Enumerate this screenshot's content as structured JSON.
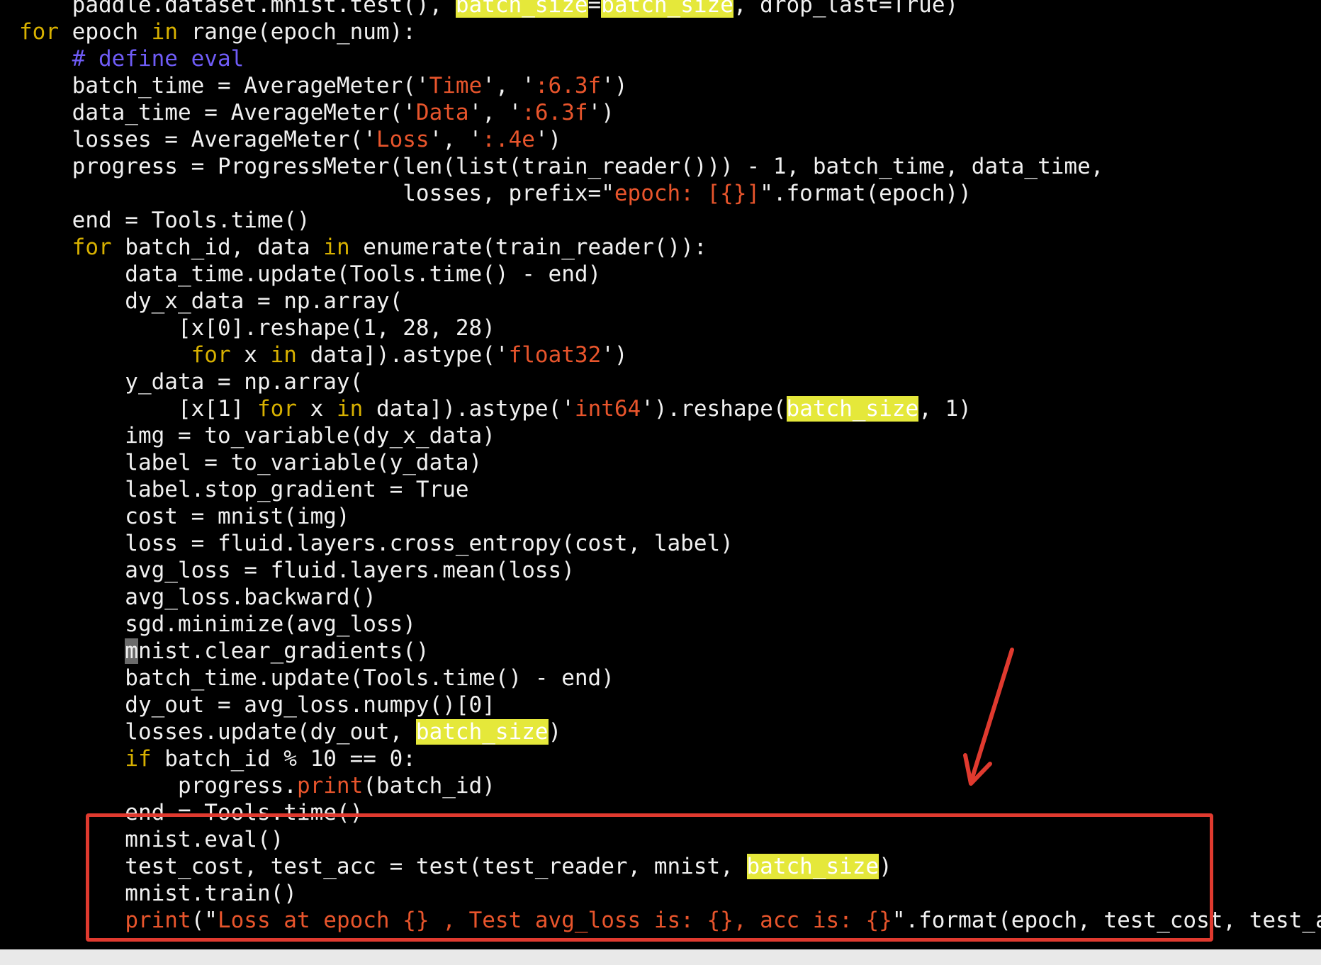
{
  "code": {
    "lines": [
      {
        "segments": [
          {
            "t": "    paddle.dataset.mnist.test(), ",
            "c": "p"
          },
          {
            "t": "batch_size",
            "c": "hl"
          },
          {
            "t": "=",
            "c": "p"
          },
          {
            "t": "batch_size",
            "c": "hl"
          },
          {
            "t": ", drop_last=True)",
            "c": "p"
          }
        ]
      },
      {
        "segments": [
          {
            "t": "for",
            "c": "kw"
          },
          {
            "t": " epoch ",
            "c": "p"
          },
          {
            "t": "in",
            "c": "kw"
          },
          {
            "t": " range(epoch_num):",
            "c": "p"
          }
        ]
      },
      {
        "segments": [
          {
            "t": "    ",
            "c": "p"
          },
          {
            "t": "# define eval",
            "c": "com"
          }
        ]
      },
      {
        "segments": [
          {
            "t": "    batch_time = AverageMeter('",
            "c": "p"
          },
          {
            "t": "Time",
            "c": "str"
          },
          {
            "t": "', '",
            "c": "p"
          },
          {
            "t": ":6.3f",
            "c": "str"
          },
          {
            "t": "')",
            "c": "p"
          }
        ]
      },
      {
        "segments": [
          {
            "t": "    data_time = AverageMeter('",
            "c": "p"
          },
          {
            "t": "Data",
            "c": "str"
          },
          {
            "t": "', '",
            "c": "p"
          },
          {
            "t": ":6.3f",
            "c": "str"
          },
          {
            "t": "')",
            "c": "p"
          }
        ]
      },
      {
        "segments": [
          {
            "t": "    losses = AverageMeter('",
            "c": "p"
          },
          {
            "t": "Loss",
            "c": "str"
          },
          {
            "t": "', '",
            "c": "p"
          },
          {
            "t": ":.4e",
            "c": "str"
          },
          {
            "t": "')",
            "c": "p"
          }
        ]
      },
      {
        "segments": [
          {
            "t": "    progress = ProgressMeter(len(list(train_reader())) - 1, batch_time, data_time,",
            "c": "p"
          }
        ]
      },
      {
        "segments": [
          {
            "t": "                             losses, prefix=\"",
            "c": "p"
          },
          {
            "t": "epoch: [{}]",
            "c": "str"
          },
          {
            "t": "\".format(epoch))",
            "c": "p"
          }
        ]
      },
      {
        "segments": [
          {
            "t": "    end = Tools.time()",
            "c": "p"
          }
        ]
      },
      {
        "segments": [
          {
            "t": "    ",
            "c": "p"
          },
          {
            "t": "for",
            "c": "kw"
          },
          {
            "t": " batch_id, data ",
            "c": "p"
          },
          {
            "t": "in",
            "c": "kw"
          },
          {
            "t": " enumerate(train_reader()):",
            "c": "p"
          }
        ]
      },
      {
        "segments": [
          {
            "t": "        data_time.update(Tools.time() - end)",
            "c": "p"
          }
        ]
      },
      {
        "segments": [
          {
            "t": "        dy_x_data = np.array(",
            "c": "p"
          }
        ]
      },
      {
        "segments": [
          {
            "t": "            [x[0].reshape(1, 28, 28)",
            "c": "p"
          }
        ]
      },
      {
        "segments": [
          {
            "t": "             ",
            "c": "p"
          },
          {
            "t": "for",
            "c": "kw"
          },
          {
            "t": " x ",
            "c": "p"
          },
          {
            "t": "in",
            "c": "kw"
          },
          {
            "t": " data]).astype('",
            "c": "p"
          },
          {
            "t": "float32",
            "c": "str"
          },
          {
            "t": "')",
            "c": "p"
          }
        ]
      },
      {
        "segments": [
          {
            "t": "        y_data = np.array(",
            "c": "p"
          }
        ]
      },
      {
        "segments": [
          {
            "t": "            [x[1] ",
            "c": "p"
          },
          {
            "t": "for",
            "c": "kw"
          },
          {
            "t": " x ",
            "c": "p"
          },
          {
            "t": "in",
            "c": "kw"
          },
          {
            "t": " data]).astype('",
            "c": "p"
          },
          {
            "t": "int64",
            "c": "str"
          },
          {
            "t": "').reshape(",
            "c": "p"
          },
          {
            "t": "batch_size",
            "c": "hl"
          },
          {
            "t": ", 1)",
            "c": "p"
          }
        ]
      },
      {
        "segments": [
          {
            "t": "        img = to_variable(dy_x_data)",
            "c": "p"
          }
        ]
      },
      {
        "segments": [
          {
            "t": "        label = to_variable(y_data)",
            "c": "p"
          }
        ]
      },
      {
        "segments": [
          {
            "t": "        label.stop_gradient = True",
            "c": "p"
          }
        ]
      },
      {
        "segments": [
          {
            "t": "        cost = mnist(img)",
            "c": "p"
          }
        ]
      },
      {
        "segments": [
          {
            "t": "        loss = fluid.layers.cross_entropy(cost, label)",
            "c": "p"
          }
        ]
      },
      {
        "segments": [
          {
            "t": "        avg_loss = fluid.layers.mean(loss)",
            "c": "p"
          }
        ]
      },
      {
        "segments": [
          {
            "t": "        avg_loss.backward()",
            "c": "p"
          }
        ]
      },
      {
        "segments": [
          {
            "t": "        sgd.minimize(avg_loss)",
            "c": "p"
          }
        ]
      },
      {
        "segments": [
          {
            "t": "        ",
            "c": "p"
          },
          {
            "t": "m",
            "c": "cur"
          },
          {
            "t": "nist.clear_gradients()",
            "c": "p"
          }
        ]
      },
      {
        "segments": [
          {
            "t": "        batch_time.update(Tools.time() - end)",
            "c": "p"
          }
        ]
      },
      {
        "segments": [
          {
            "t": "        dy_out = avg_loss.numpy()[0]",
            "c": "p"
          }
        ]
      },
      {
        "segments": [
          {
            "t": "        losses.update(dy_out, ",
            "c": "p"
          },
          {
            "t": "batch_size",
            "c": "hl"
          },
          {
            "t": ")",
            "c": "p"
          }
        ]
      },
      {
        "segments": [
          {
            "t": "        ",
            "c": "p"
          },
          {
            "t": "if",
            "c": "kw"
          },
          {
            "t": " batch_id % 10 == 0:",
            "c": "p"
          }
        ]
      },
      {
        "segments": [
          {
            "t": "            progress.",
            "c": "p"
          },
          {
            "t": "print",
            "c": "str"
          },
          {
            "t": "(batch_id)",
            "c": "p"
          }
        ]
      },
      {
        "segments": [
          {
            "t": "        end = Tools.time()",
            "c": "p"
          }
        ]
      },
      {
        "segments": [
          {
            "t": "        mnist.eval()",
            "c": "p"
          }
        ]
      },
      {
        "segments": [
          {
            "t": "        test_cost, test_acc = test(test_reader, mnist, ",
            "c": "p"
          },
          {
            "t": "batch_size",
            "c": "hl"
          },
          {
            "t": ")",
            "c": "p"
          }
        ]
      },
      {
        "segments": [
          {
            "t": "        mnist.train()",
            "c": "p"
          }
        ]
      },
      {
        "segments": [
          {
            "t": "        ",
            "c": "p"
          },
          {
            "t": "print",
            "c": "str"
          },
          {
            "t": "(\"",
            "c": "p"
          },
          {
            "t": "Loss at epoch {} , Test avg_loss is: {}, acc is: {}",
            "c": "str"
          },
          {
            "t": "\".format(epoch, test_cost, test_acc))",
            "c": "p"
          }
        ]
      }
    ]
  },
  "annotation": {
    "box_color": "#e03a2f",
    "arrow_color": "#e03a2f"
  },
  "colors": {
    "background": "#000000",
    "plain_text": "#f0f0f0",
    "keyword": "#d8b100",
    "string": "#e8552c",
    "comment": "#6f5cf7",
    "search_highlight": "#e5e83a"
  }
}
